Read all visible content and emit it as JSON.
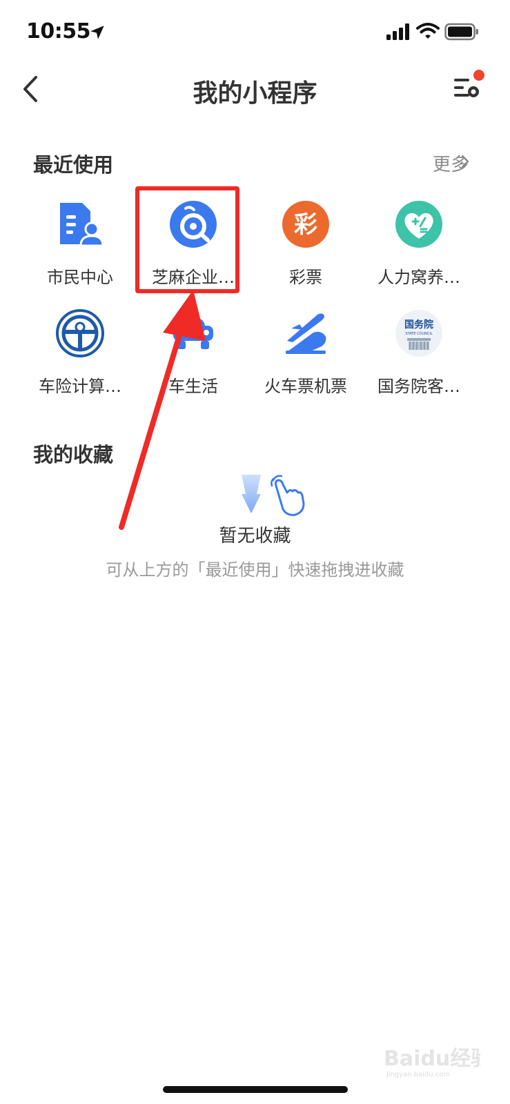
{
  "status_bar": {
    "time": "10:55"
  },
  "header": {
    "title": "我的小程序"
  },
  "recent": {
    "title": "最近使用",
    "more_label": "更多",
    "apps": [
      {
        "label": "市民中心",
        "icon": "citizen-center-icon"
      },
      {
        "label": "芝麻企业…",
        "icon": "zhima-enterprise-icon"
      },
      {
        "label": "彩票",
        "icon": "lottery-icon",
        "glyph": "彩"
      },
      {
        "label": "人力窝养…",
        "icon": "health-calc-icon"
      },
      {
        "label": "车险计算…",
        "icon": "car-insurance-icon"
      },
      {
        "label": "车生活",
        "icon": "car-life-icon"
      },
      {
        "label": "火车票机票",
        "icon": "train-plane-ticket-icon"
      },
      {
        "label": "国务院客…",
        "icon": "state-council-icon",
        "glyph": "国务院",
        "sub_text": "STATE COUNCIL"
      }
    ]
  },
  "favorites": {
    "title": "我的收藏",
    "empty_title": "暂无收藏",
    "empty_hint": "可从上方的「最近使用」快速拖拽进收藏"
  },
  "watermark": {
    "text": "Baidu经验",
    "sub_text": "jingyan.baidu.com"
  },
  "colors": {
    "accent_red": "#f02a26",
    "blue": "#3b79ee",
    "orange": "#ec6a2e",
    "teal": "#3cc3a8",
    "dark_blue": "#1d5aa8"
  }
}
